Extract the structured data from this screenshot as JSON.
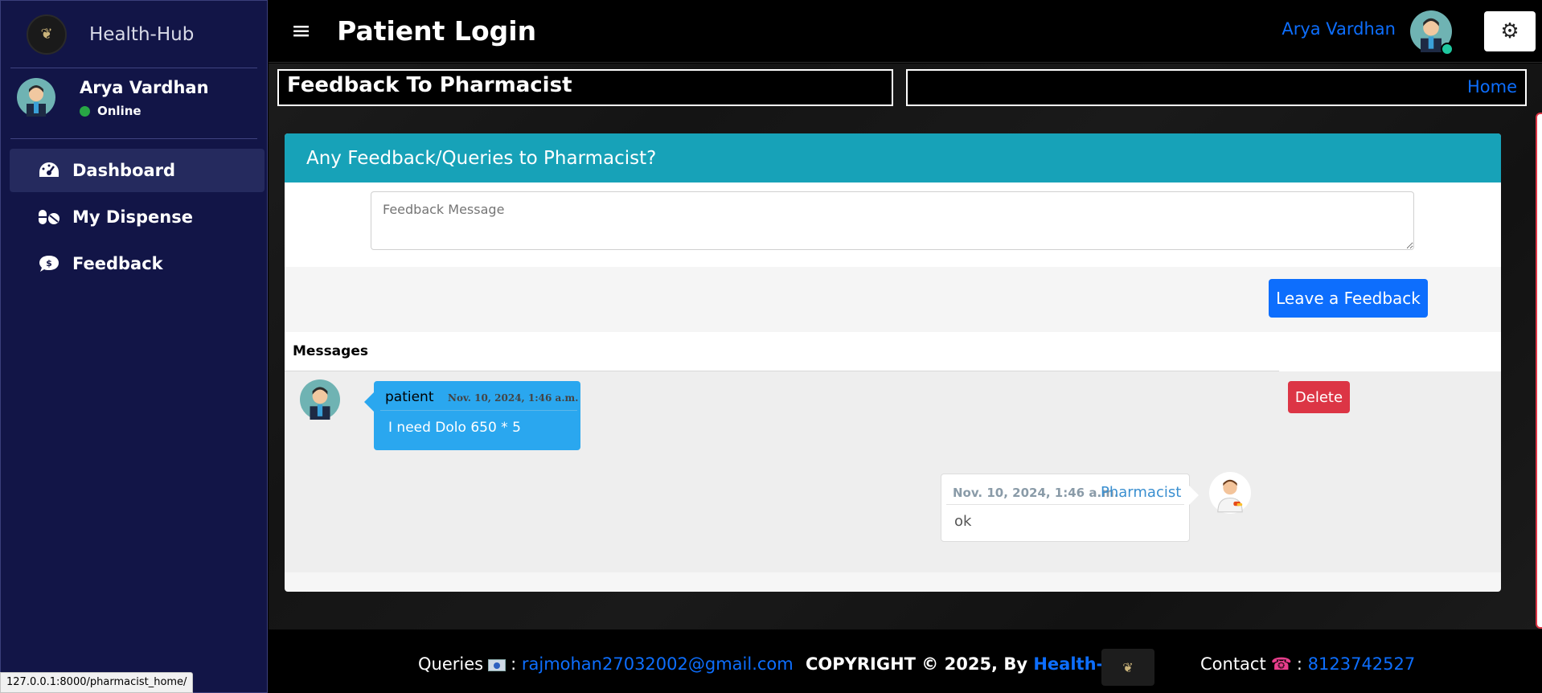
{
  "sidebar": {
    "brand": "Health-Hub",
    "user": {
      "name": "Arya Vardhan",
      "status": "Online"
    },
    "items": [
      {
        "label": "Dashboard",
        "icon": "dashboard-icon"
      },
      {
        "label": "My Dispense",
        "icon": "pills-icon"
      },
      {
        "label": "Feedback",
        "icon": "comment-dollar-icon"
      }
    ]
  },
  "topbar": {
    "title": "Patient Login",
    "user_name": "Arya Vardhan"
  },
  "page": {
    "heading": "Feedback To Pharmacist",
    "breadcrumb": "Home"
  },
  "card": {
    "header": "Any Feedback/Queries to Pharmacist?",
    "input_placeholder": "Feedback Message",
    "submit_label": "Leave a Feedback",
    "messages_label": "Messages",
    "messages": [
      {
        "author": "patient",
        "time": "Nov. 10, 2024, 1:46 a.m.",
        "text": "I need Dolo 650 * 5",
        "delete_label": "Delete"
      },
      {
        "author": "Pharmacist",
        "time": "Nov. 10, 2024, 1:46 a.m.",
        "text": "ok"
      }
    ]
  },
  "footer": {
    "queries_label": "Queries",
    "email": "rajmohan27032002@gmail.com",
    "copyright": "COPYRIGHT © 2025, By",
    "brand": "Health-Hub",
    "contact_label": "Contact",
    "phone": "8123742527"
  },
  "status_url": "127.0.0.1:8000/pharmacist_home/",
  "colors": {
    "sidebar_bg": "#121547",
    "accent_blue": "#0d6efd",
    "card_header": "#17a2b8",
    "patient_bubble": "#2aa7ef",
    "delete_red": "#dc3545"
  }
}
